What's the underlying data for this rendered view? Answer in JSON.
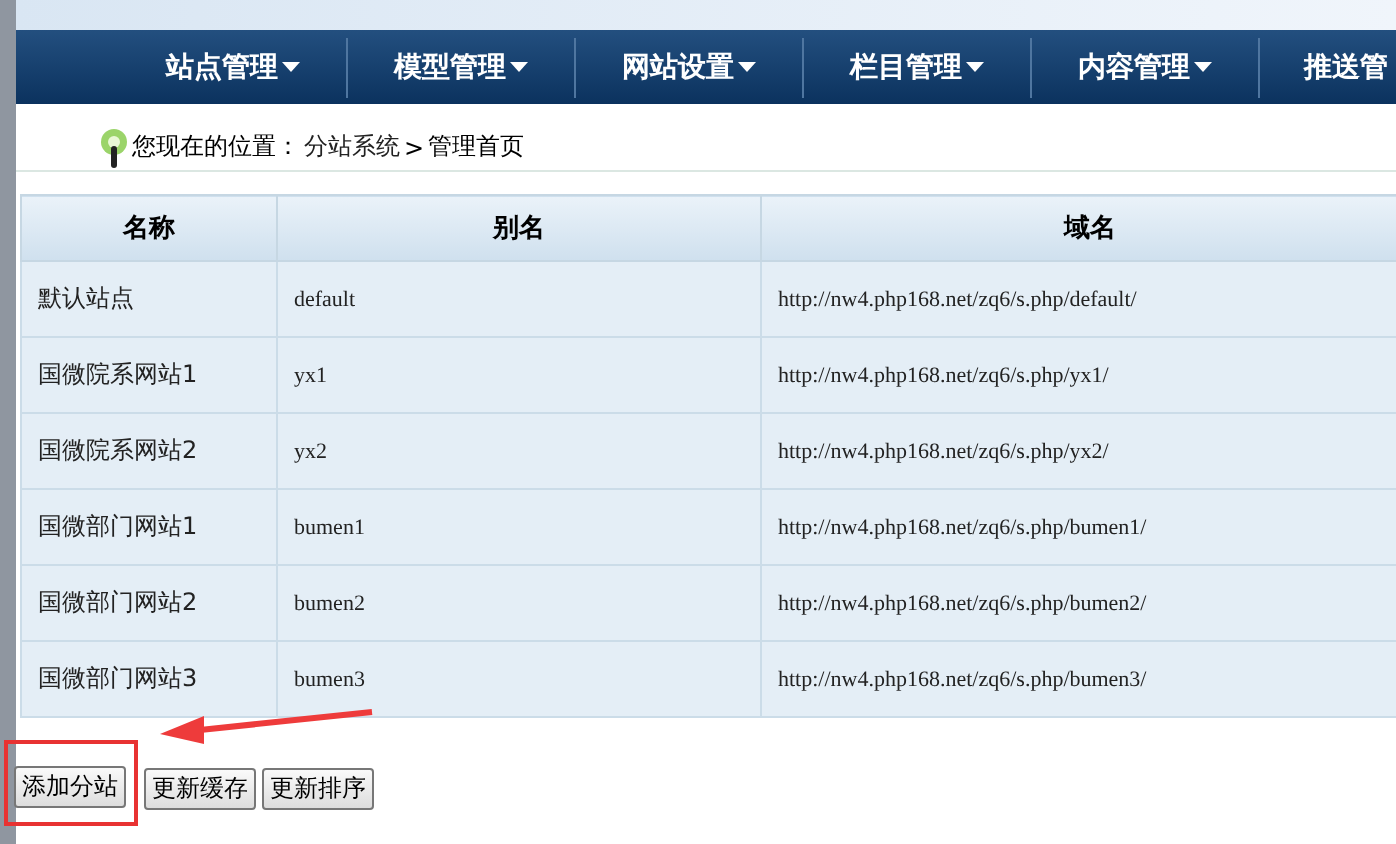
{
  "nav": [
    {
      "label": "站点管理",
      "dropdown": true
    },
    {
      "label": "模型管理",
      "dropdown": true
    },
    {
      "label": "网站设置",
      "dropdown": true
    },
    {
      "label": "栏目管理",
      "dropdown": true
    },
    {
      "label": "内容管理",
      "dropdown": true
    },
    {
      "label": "推送管",
      "dropdown": false
    }
  ],
  "breadcrumb": {
    "prefix": "您现在的位置：",
    "path": "分站系统",
    "separator": ">",
    "current": "管理首页"
  },
  "table": {
    "columns": [
      "名称",
      "别名",
      "域名"
    ],
    "rows": [
      [
        "默认站点",
        "default",
        "http://nw4.php168.net/zq6/s.php/default/"
      ],
      [
        "国微院系网站1",
        "yx1",
        "http://nw4.php168.net/zq6/s.php/yx1/"
      ],
      [
        "国微院系网站2",
        "yx2",
        "http://nw4.php168.net/zq6/s.php/yx2/"
      ],
      [
        "国微部门网站1",
        "bumen1",
        "http://nw4.php168.net/zq6/s.php/bumen1/"
      ],
      [
        "国微部门网站2",
        "bumen2",
        "http://nw4.php168.net/zq6/s.php/bumen2/"
      ],
      [
        "国微部门网站3",
        "bumen3",
        "http://nw4.php168.net/zq6/s.php/bumen3/"
      ]
    ]
  },
  "buttons": [
    {
      "label": "添加分站",
      "highlighted": true
    },
    {
      "label": "更新缓存",
      "highlighted": false
    },
    {
      "label": "更新排序",
      "highlighted": false
    }
  ]
}
